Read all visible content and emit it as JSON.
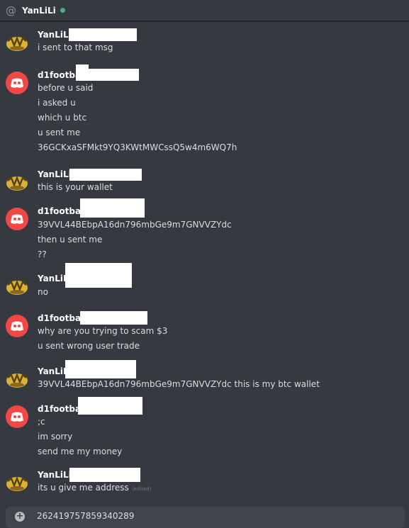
{
  "header": {
    "at_symbol": "@",
    "name": "YanLiLi",
    "status_color": "#43b581"
  },
  "messages": [
    {
      "author": "YanLiLi",
      "avatar": "yanlili-avatar",
      "lines": [
        "i sent to that msg"
      ]
    },
    {
      "author": "d1football",
      "avatar": "discord-avatar",
      "lines": [
        "before u said",
        "i asked u",
        "which u btc",
        "u sent me",
        "36GCKxaSFMkt9YQ3KWtMWCssQ5w4m6WQ7h"
      ]
    },
    {
      "author": "YanLiLi",
      "avatar": "yanlili-avatar",
      "lines": [
        "this is your wallet"
      ]
    },
    {
      "author": "d1football",
      "avatar": "discord-avatar",
      "lines": [
        "39VVL44BEbpA16dn796mbGe9m7GNVVZYdc",
        "then u sent me",
        "??"
      ]
    },
    {
      "author": "YanLiLi",
      "avatar": "yanlili-avatar",
      "lines": [
        "no"
      ]
    },
    {
      "author": "d1football",
      "avatar": "discord-avatar",
      "lines": [
        "why are you trying to scam $3",
        "u sent wrong user trade"
      ]
    },
    {
      "author": "YanLiLi",
      "avatar": "yanlili-avatar",
      "lines": [
        "39VVL44BEbpA16dn796mbGe9m7GNVVZYdc  this is my btc wallet"
      ]
    },
    {
      "author": "d1football",
      "avatar": "discord-avatar",
      "lines": [
        ";c",
        "im sorry",
        "send me my money"
      ]
    },
    {
      "author": "YanLiLi",
      "avatar": "yanlili-avatar",
      "lines": [
        "its u give  me address"
      ],
      "edited": "(edited)"
    }
  ],
  "composer": {
    "plus": "+",
    "text": "262419757859340289"
  },
  "colors": {
    "background": "#36393f",
    "discord_red": "#f04747",
    "yanlili_gold": "#d9b23a",
    "online_green": "#43b581"
  }
}
